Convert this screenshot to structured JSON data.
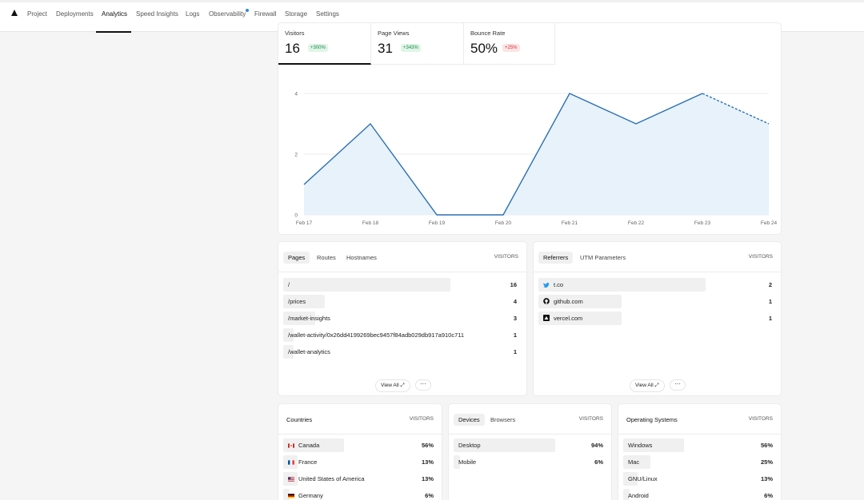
{
  "nav": {
    "tabs": [
      {
        "label": "Project"
      },
      {
        "label": "Deployments"
      },
      {
        "label": "Analytics"
      },
      {
        "label": "Speed Insights"
      },
      {
        "label": "Logs"
      },
      {
        "label": "Observability"
      },
      {
        "label": "Firewall"
      },
      {
        "label": "Storage"
      },
      {
        "label": "Settings"
      }
    ],
    "active_tab": "Analytics"
  },
  "stats": [
    {
      "label": "Visitors",
      "value": "16",
      "change": "+300%",
      "trend": "up"
    },
    {
      "label": "Page Views",
      "value": "31",
      "change": "+343%",
      "trend": "up"
    },
    {
      "label": "Bounce Rate",
      "value": "50%",
      "change": "+25%",
      "trend": "down"
    }
  ],
  "chart_data": {
    "type": "area",
    "x": [
      "Feb 17",
      "Feb 18",
      "Feb 19",
      "Feb 20",
      "Feb 21",
      "Feb 22",
      "Feb 23",
      "Feb 24"
    ],
    "series": [
      {
        "values": [
          1,
          3,
          0,
          0,
          4,
          3,
          4,
          3
        ]
      }
    ],
    "projected_from_index": 6,
    "y_ticks": [
      "0",
      "2",
      "4"
    ],
    "ylim": [
      0,
      4
    ],
    "grid": true,
    "color": "#2a6fb5"
  },
  "pages": {
    "tabs": [
      "Pages",
      "Routes",
      "Hostnames"
    ],
    "header": "VISITORS",
    "rows": [
      {
        "name": "/",
        "count": "16",
        "fraction": 1.0
      },
      {
        "name": "/prices",
        "count": "4",
        "fraction": 0.25
      },
      {
        "name": "/market-insights",
        "count": "3",
        "fraction": 0.19
      },
      {
        "name": "/wallet-activity/0x26dd4199269bec9457f84adb029db917a910c711",
        "count": "1",
        "fraction": 0.06
      },
      {
        "name": "/wallet-analytics",
        "count": "1",
        "fraction": 0.06
      }
    ],
    "view_all": "View All"
  },
  "referrers": {
    "tabs": [
      "Referrers",
      "UTM Parameters"
    ],
    "header": "VISITORS",
    "rows": [
      {
        "name": "t.co",
        "count": "2",
        "icon": "twitter-icon",
        "fraction": 1.0
      },
      {
        "name": "github.com",
        "count": "1",
        "icon": "github-icon",
        "fraction": 0.5
      },
      {
        "name": "vercel.com",
        "count": "1",
        "icon": "vercel-icon",
        "fraction": 0.5
      }
    ],
    "view_all": "View All"
  },
  "countries": {
    "title": "Countries",
    "header": "VISITORS",
    "rows": [
      {
        "name": "Canada",
        "pct": "56%",
        "icon": "canada-flag-icon",
        "fraction": 0.56
      },
      {
        "name": "France",
        "pct": "13%",
        "icon": "france-flag-icon",
        "fraction": 0.13
      },
      {
        "name": "United States of America",
        "pct": "13%",
        "icon": "usa-flag-icon",
        "fraction": 0.13
      },
      {
        "name": "Germany",
        "pct": "6%",
        "icon": "germany-flag-icon",
        "fraction": 0.06
      }
    ]
  },
  "devices": {
    "tabs": [
      "Devices",
      "Browsers"
    ],
    "header": "VISITORS",
    "rows": [
      {
        "name": "Desktop",
        "pct": "94%",
        "fraction": 0.94
      },
      {
        "name": "Mobile",
        "pct": "6%",
        "fraction": 0.06
      }
    ]
  },
  "os": {
    "title": "Operating Systems",
    "header": "VISITORS",
    "rows": [
      {
        "name": "Windows",
        "pct": "56%",
        "fraction": 0.56
      },
      {
        "name": "Mac",
        "pct": "25%",
        "fraction": 0.25
      },
      {
        "name": "GNU/Linux",
        "pct": "13%",
        "fraction": 0.13
      },
      {
        "name": "Android",
        "pct": "6%",
        "fraction": 0.06
      }
    ]
  }
}
